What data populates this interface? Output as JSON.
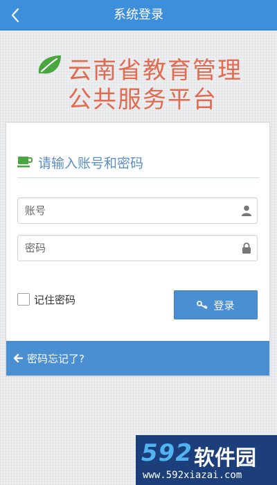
{
  "header": {
    "title": "系统登录",
    "back_icon": "chevron-left-icon",
    "background": "#3d8fdc"
  },
  "brand": {
    "logo_icon": "leaf-icon",
    "line1": "云南省教育管理",
    "line2": "公共服务平台",
    "color": "#e06a52",
    "logo_color": "#4aa63f"
  },
  "login_card": {
    "title": "请输入账号和密码",
    "title_icon": "cup-icon",
    "account": {
      "placeholder": "账号",
      "value": "",
      "icon": "user-icon"
    },
    "password": {
      "placeholder": "密码",
      "value": "",
      "icon": "lock-icon"
    },
    "remember_label": "记住密码",
    "remember_checked": false,
    "login_button": {
      "label": "登录",
      "icon": "key-icon"
    },
    "forgot_link": {
      "label": "密码忘记了?",
      "icon": "arrow-left-icon"
    },
    "accent": "#4a8fd1"
  },
  "watermark": {
    "number": "592",
    "text": "软件园",
    "url": "www.592xiazai.com"
  }
}
